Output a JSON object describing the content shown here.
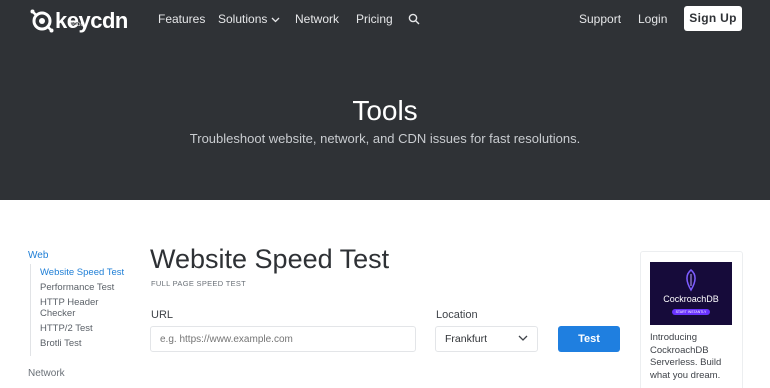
{
  "brand": {
    "name": "keycdn",
    "sub": "Tools"
  },
  "nav": {
    "features": "Features",
    "solutions": "Solutions",
    "network": "Network",
    "pricing": "Pricing",
    "support": "Support",
    "login": "Login",
    "signup": "Sign Up"
  },
  "hero": {
    "title": "Tools",
    "subtitle": "Troubleshoot website, network, and CDN issues for fast resolutions."
  },
  "sidebar": {
    "category_web": "Web",
    "items": [
      {
        "label": "Website Speed Test",
        "active": true
      },
      {
        "label": "Performance Test"
      },
      {
        "label": "HTTP Header Checker"
      },
      {
        "label": "HTTP/2 Test"
      },
      {
        "label": "Brotli Test"
      }
    ],
    "category_network": "Network"
  },
  "main": {
    "title": "Website Speed Test",
    "subtitle": "FULL PAGE SPEED TEST",
    "url_label": "URL",
    "url_placeholder": "e.g. https://www.example.com",
    "url_value": "",
    "location_label": "Location",
    "location_value": "Frankfurt",
    "test_button": "Test"
  },
  "ad": {
    "image_title": "CockroachDB",
    "image_button": "START INSTANTLY",
    "text": "Introducing CockroachDB Serverless. Build what you dream."
  },
  "colors": {
    "header_bg": "#2f3236",
    "accent": "#1f7fe0",
    "link_active": "#1e7ed6"
  },
  "icons": [
    "keycdn-logo-icon",
    "chevron-down-icon",
    "search-icon"
  ]
}
